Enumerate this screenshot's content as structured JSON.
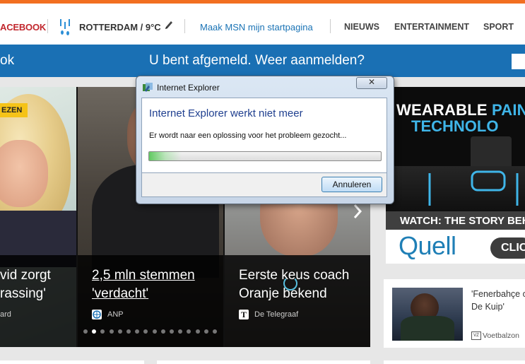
{
  "header": {
    "facebook_label": "ACEBOOK",
    "city_weather": "ROTTERDAM / 9°C",
    "msn_start": "Maak MSN mijn startpagina",
    "nav": [
      "NIEUWS",
      "ENTERTAINMENT",
      "SPORT"
    ]
  },
  "banner": {
    "left_label": "ok",
    "message": "U bent afgemeld. Weer aanmelden?"
  },
  "slideshow": {
    "badge": "EZEN",
    "slides": [
      {
        "title_line1": "vid zorgt",
        "title_line2": "rassing'",
        "source": "ard"
      },
      {
        "title_line1": "2,5 mln stemmen",
        "title_line2": "'verdacht'",
        "source": "ANP"
      },
      {
        "title_line1": "Eerste keus coach",
        "title_line2": "Oranje bekend",
        "source": "De Telegraaf"
      }
    ],
    "dot_count": 16,
    "active_dot": 1
  },
  "ad": {
    "line1_white": "WEARABLE ",
    "line1_blue": "PAIN",
    "line2": "TECHNOLO",
    "watch": "WATCH: THE STORY BEH",
    "brand": "Quell",
    "click": "CLIC",
    "accent_color": "#3fb5e8"
  },
  "news_card": {
    "title_line1": "'Fenerbahçe o",
    "title_line2": "De Kuip'",
    "source_icon": "VZ",
    "source": "Voetbalzon"
  },
  "dialog": {
    "title": "Internet Explorer",
    "heading": "Internet Explorer werkt niet meer",
    "message": "Er wordt naar een oplossing voor het probleem gezocht...",
    "progress": 0.14,
    "cancel_label": "Annuleren",
    "close_glyph": "✕"
  }
}
